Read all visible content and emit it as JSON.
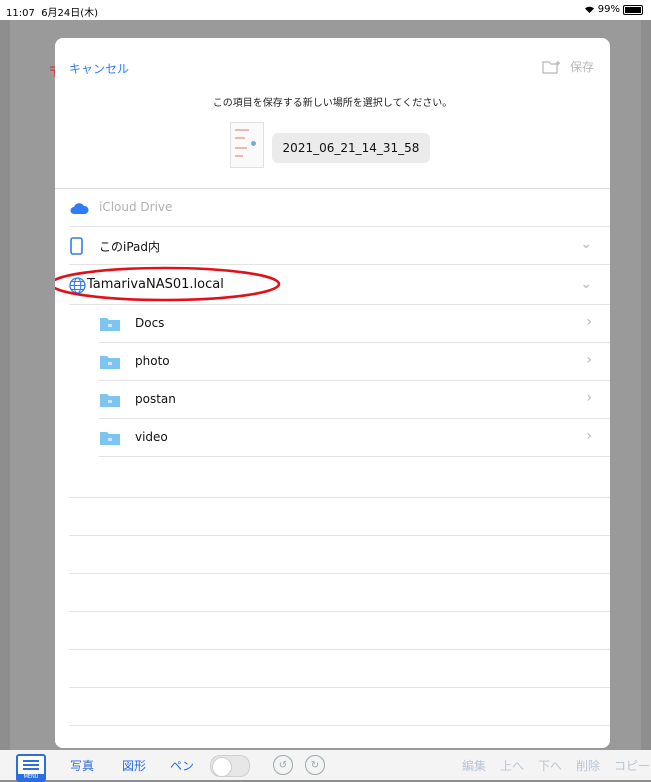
{
  "status": {
    "time": "11:07",
    "date": "6月24日(木)",
    "battery": "99%"
  },
  "dialog": {
    "cancel": "キャンセル",
    "save": "保存",
    "prompt": "この項目を保存する新しい場所を選択してください。",
    "filename": "2021_06_21_14_31_58"
  },
  "locations": {
    "icloud": "iCloud Drive",
    "ipad": "このiPad内",
    "nas": "TamarivaNAS01.local",
    "folders": [
      {
        "label": "Docs"
      },
      {
        "label": "photo"
      },
      {
        "label": "postan"
      },
      {
        "label": "video"
      }
    ]
  },
  "toolbar": {
    "menu": "MENU",
    "photo": "写真",
    "shape": "図形",
    "pen": "ペン",
    "edit": "編集",
    "up": "上へ",
    "down": "下へ",
    "delete": "削除",
    "copy": "コピー"
  },
  "colors": {
    "accent": "#2f7cf6",
    "highlight": "#e0111a",
    "folder": "#7dc4f0"
  }
}
